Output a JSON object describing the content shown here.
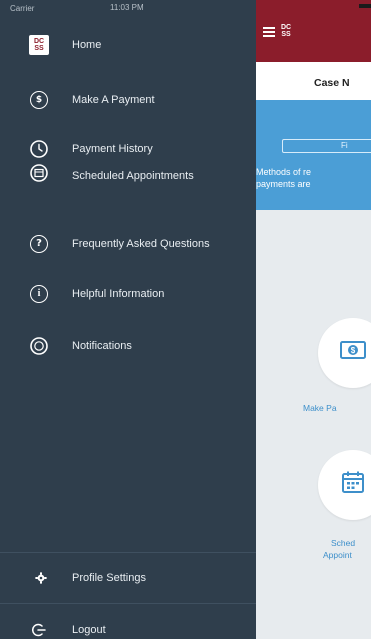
{
  "status_bar": {
    "carrier": "Carrier",
    "time": "11:03 PM"
  },
  "drawer": {
    "items": [
      {
        "label": "Home",
        "icon": "dcss-logo-icon"
      },
      {
        "label": "Make A Payment",
        "icon": "dollar-circle-icon"
      },
      {
        "label": "Payment History",
        "icon": "history-circle-icon"
      },
      {
        "label": "Scheduled Appointments",
        "icon": "calendar-circle-icon"
      },
      {
        "label": "Frequently Asked Questions",
        "icon": "question-circle-icon"
      },
      {
        "label": "Helpful Information",
        "icon": "info-circle-icon"
      },
      {
        "label": "Notifications",
        "icon": "notification-circle-icon"
      }
    ],
    "footer": [
      {
        "label": "Profile Settings",
        "icon": "gear-icon"
      },
      {
        "label": "Logout",
        "icon": "logout-icon"
      }
    ]
  },
  "logo": {
    "line1": "DC",
    "line2": "SS"
  },
  "main": {
    "case_title": "Case N",
    "info_button_label": "Fi",
    "info_text_line1": "Methods of re",
    "info_text_line2": "payments are",
    "tiles": [
      {
        "label": "Make Pa",
        "icon": "cash-icon"
      },
      {
        "label_line1": "Sched",
        "label_line2": "Appoint",
        "icon": "calendar-icon"
      }
    ]
  },
  "colors": {
    "drawer_bg": "#2f3e4c",
    "header_bg": "#8b1d2b",
    "info_bg": "#4b9ed6",
    "accent_text": "#3d8fca"
  }
}
